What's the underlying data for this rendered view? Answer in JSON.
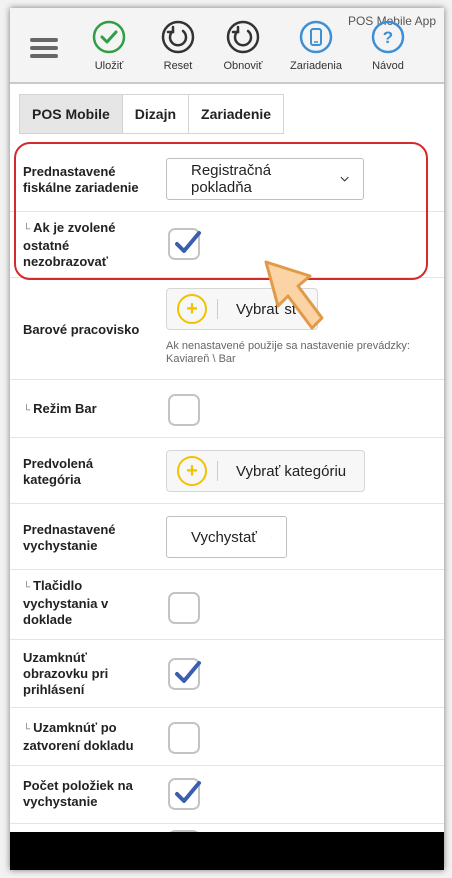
{
  "header": {
    "app_title": "POS Mobile App",
    "tools": [
      {
        "label": "Uložiť",
        "icon": "check-circle-icon",
        "color": "#2f9e44"
      },
      {
        "label": "Reset",
        "icon": "reset-icon",
        "color": "#333333"
      },
      {
        "label": "Obnoviť",
        "icon": "refresh-icon",
        "color": "#333333"
      },
      {
        "label": "Zariadenia",
        "icon": "device-icon",
        "color": "#3d8fd6"
      },
      {
        "label": "Návod",
        "icon": "help-icon",
        "color": "#3d8fd6"
      }
    ]
  },
  "tabs": [
    {
      "label": "POS Mobile",
      "active": true
    },
    {
      "label": "Dizajn",
      "active": false
    },
    {
      "label": "Zariadenie",
      "active": false
    }
  ],
  "rows": {
    "fiscal": {
      "label": "Prednastavené fiskálne zariadenie",
      "value": "Registračná pokladňa"
    },
    "hide_other": {
      "label": "Ak je zvolené ostatné nezobrazovať",
      "checked": true
    },
    "bar_station": {
      "label": "Barové pracovisko",
      "button": "Vybrať st",
      "hint": "Ak nenastavené použije sa nastavenie prevádzky: Kaviareň \\ Bar"
    },
    "bar_mode": {
      "label": "Režim Bar",
      "checked": false
    },
    "default_category": {
      "label": "Predvolená kategória",
      "button": "Vybrať kategóriu"
    },
    "default_dispatch": {
      "label": "Prednastavené vychystanie",
      "value": "Vychystať"
    },
    "dispatch_button": {
      "label": "Tlačidlo vychystania v doklade",
      "checked": false
    },
    "lock_login": {
      "label": "Uzamknúť obrazovku pri prihlásení",
      "checked": true
    },
    "lock_close": {
      "label": "Uzamknúť po zatvorení dokladu",
      "checked": false
    },
    "item_count": {
      "label": "Počet položiek na vychystanie",
      "checked": true
    }
  },
  "colors": {
    "highlight": "#d62a2a",
    "check": "#3a5fb0",
    "plus": "#f2c200"
  }
}
